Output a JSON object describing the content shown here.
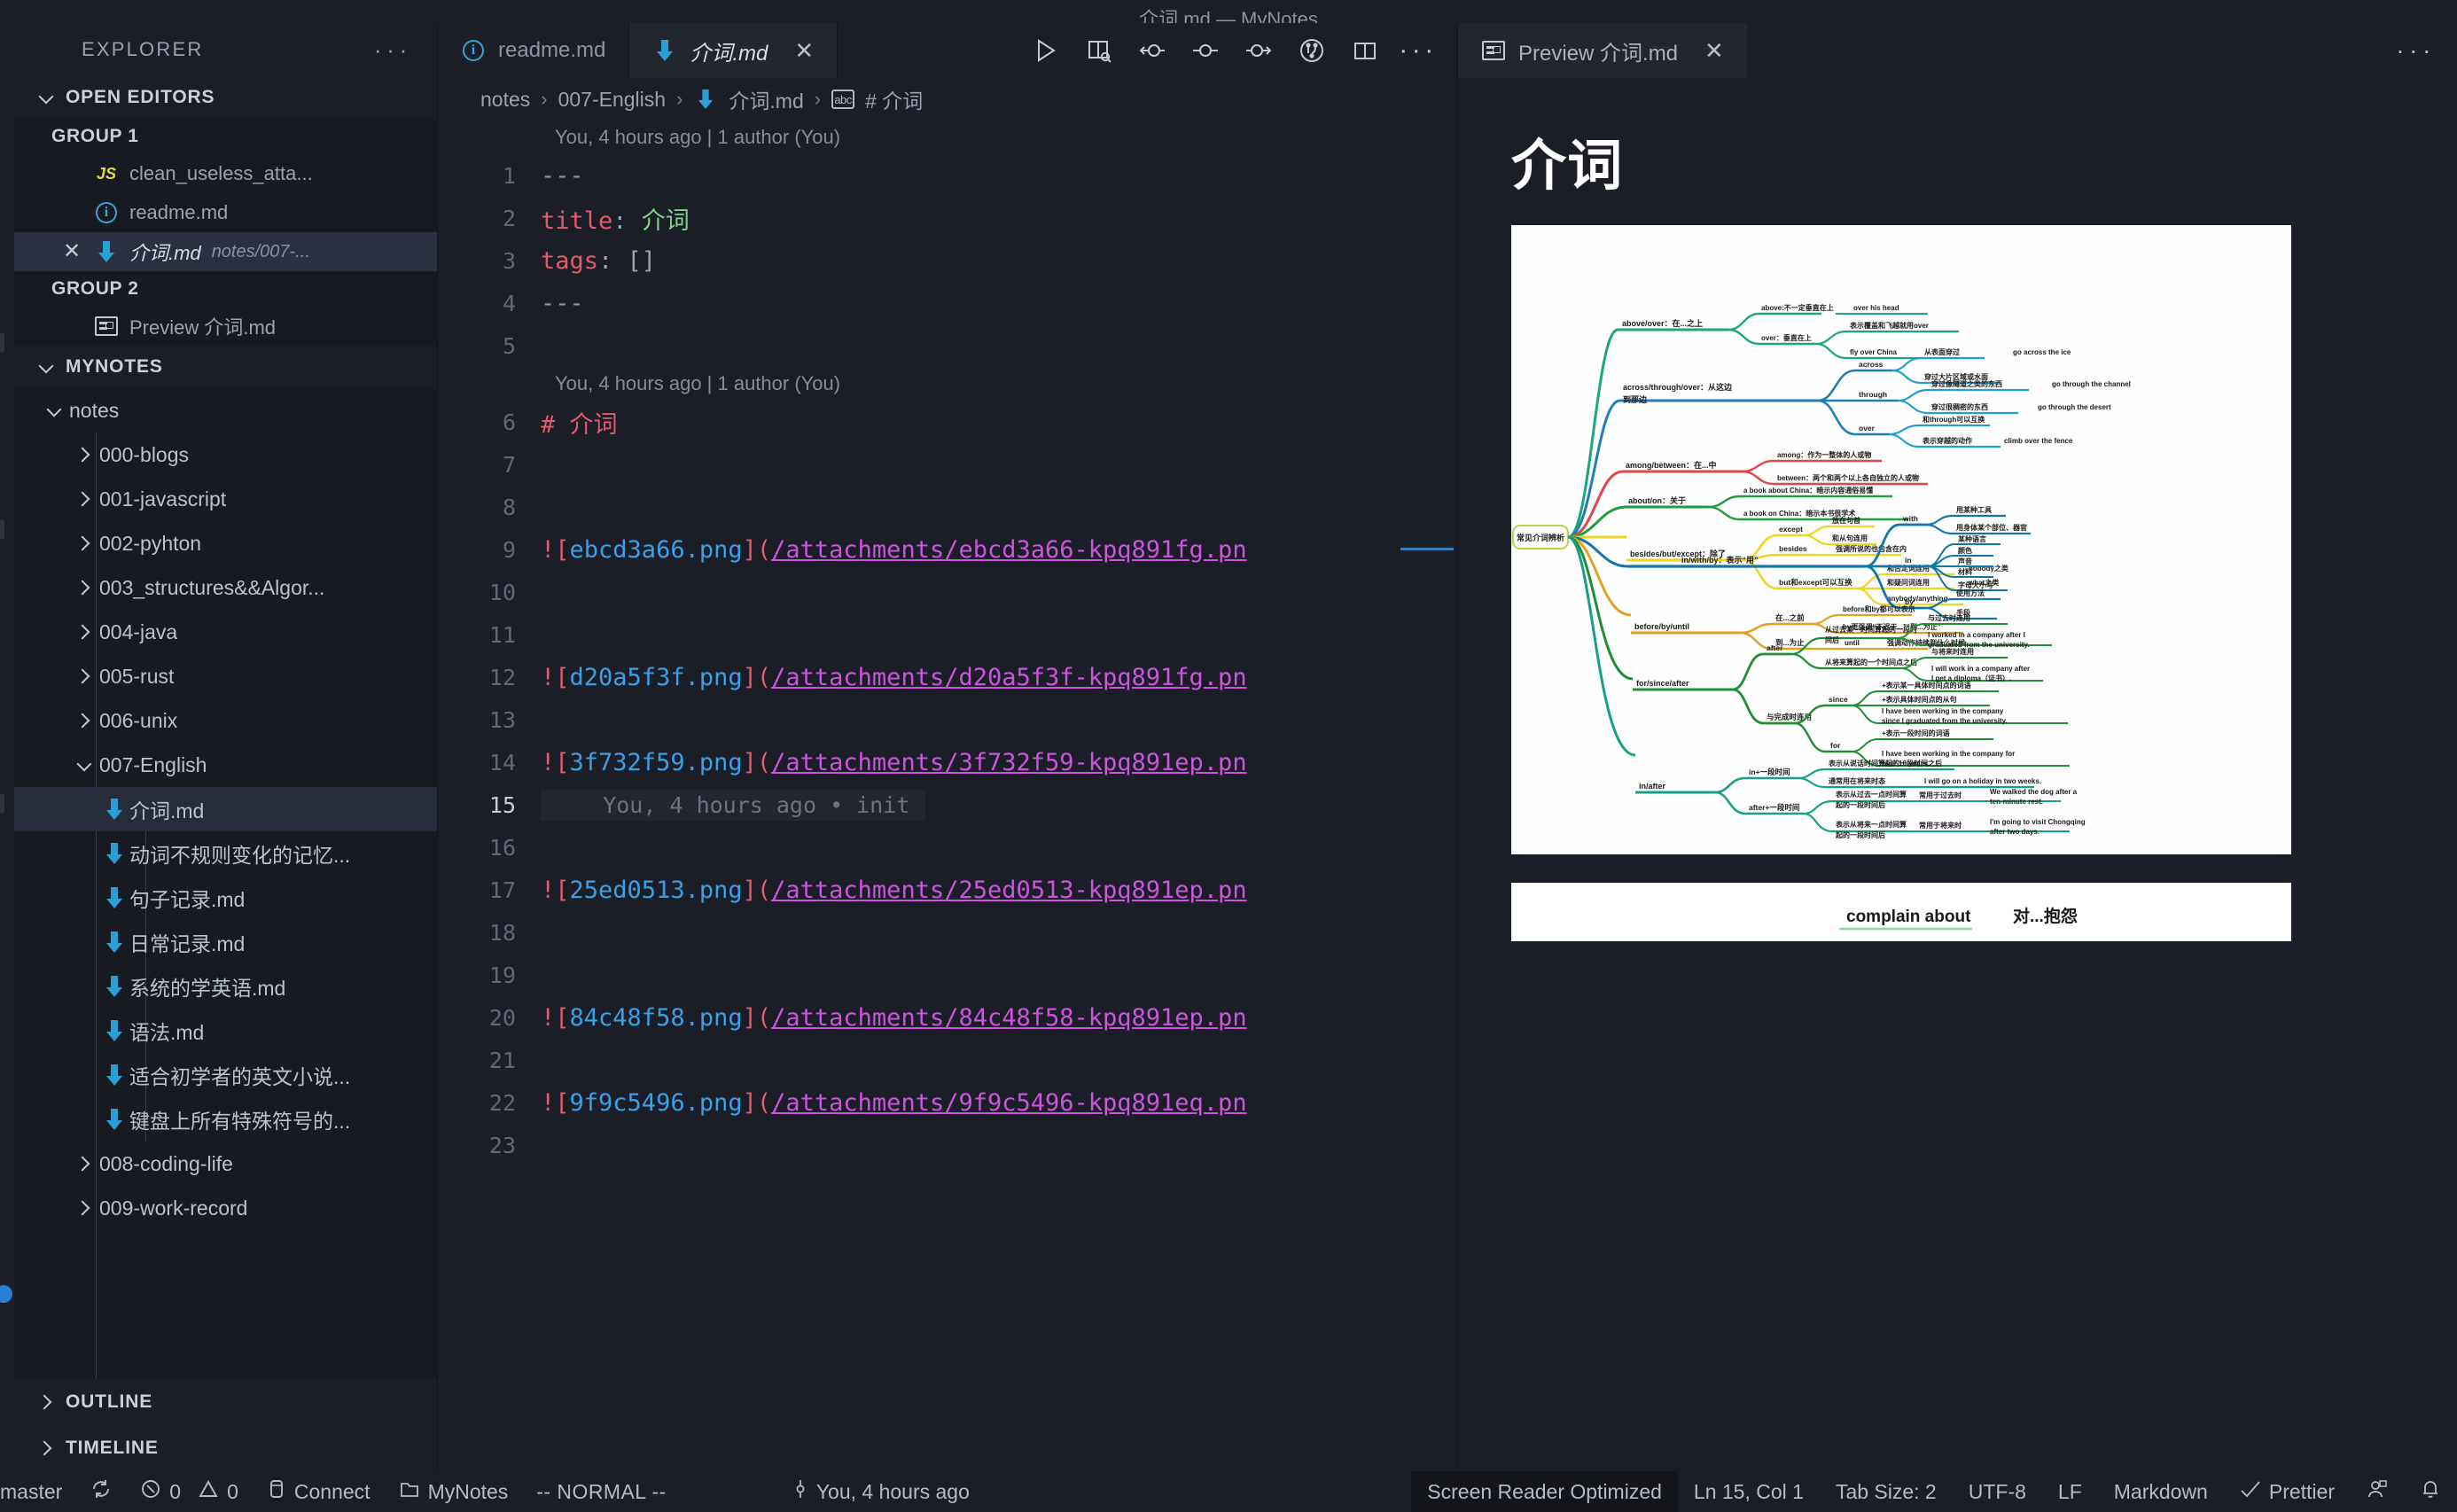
{
  "window": {
    "title": "介词.md — MyNotes"
  },
  "sidebar": {
    "header": {
      "label": "EXPLORER",
      "more": "···"
    },
    "open_editors": {
      "label": "OPEN EDITORS",
      "groups": [
        {
          "label": "GROUP 1",
          "items": [
            {
              "name": "clean_useless_atta...",
              "icon": "js-icon",
              "path": "",
              "active": false,
              "closable": false
            },
            {
              "name": "readme.md",
              "icon": "info-icon",
              "path": "",
              "active": false,
              "closable": false
            },
            {
              "name": "介词.md",
              "icon": "markdown-arrow-icon",
              "path": "notes/007-...",
              "active": true,
              "closable": true
            }
          ]
        },
        {
          "label": "GROUP 2",
          "items": [
            {
              "name": "Preview 介词.md",
              "icon": "preview-icon",
              "path": "",
              "active": false,
              "closable": false
            }
          ]
        }
      ]
    },
    "workspace": {
      "label": "MYNOTES",
      "tree": [
        {
          "label": "notes",
          "type": "folder",
          "expanded": true,
          "depth": 0
        },
        {
          "label": "000-blogs",
          "type": "folder",
          "expanded": false,
          "depth": 1
        },
        {
          "label": "001-javascript",
          "type": "folder",
          "expanded": false,
          "depth": 1
        },
        {
          "label": "002-pyhton",
          "type": "folder",
          "expanded": false,
          "depth": 1
        },
        {
          "label": "003_structures&&Algor...",
          "type": "folder",
          "expanded": false,
          "depth": 1
        },
        {
          "label": "004-java",
          "type": "folder",
          "expanded": false,
          "depth": 1
        },
        {
          "label": "005-rust",
          "type": "folder",
          "expanded": false,
          "depth": 1
        },
        {
          "label": "006-unix",
          "type": "folder",
          "expanded": false,
          "depth": 1
        },
        {
          "label": "007-English",
          "type": "folder",
          "expanded": true,
          "depth": 1
        },
        {
          "label": "介词.md",
          "type": "markdown",
          "depth": 2,
          "selected": true
        },
        {
          "label": "动词不规则变化的记忆...",
          "type": "markdown",
          "depth": 2
        },
        {
          "label": "句子记录.md",
          "type": "markdown",
          "depth": 2
        },
        {
          "label": "日常记录.md",
          "type": "markdown",
          "depth": 2
        },
        {
          "label": "系统的学英语.md",
          "type": "markdown",
          "depth": 2
        },
        {
          "label": "语法.md",
          "type": "markdown",
          "depth": 2
        },
        {
          "label": "适合初学者的英文小说...",
          "type": "markdown",
          "depth": 2
        },
        {
          "label": "键盘上所有特殊符号的...",
          "type": "markdown",
          "depth": 2
        },
        {
          "label": "008-coding-life",
          "type": "folder",
          "expanded": false,
          "depth": 1
        },
        {
          "label": "009-work-record",
          "type": "folder",
          "expanded": false,
          "depth": 1
        }
      ]
    },
    "outline": {
      "label": "OUTLINE"
    },
    "timeline": {
      "label": "TIMELINE"
    }
  },
  "editor": {
    "tabs": [
      {
        "label": "readme.md",
        "icon": "info-icon",
        "active": false,
        "closable": false
      },
      {
        "label": "介词.md",
        "icon": "markdown-arrow-icon",
        "active": true,
        "closable": true
      }
    ],
    "toolbar": [
      {
        "name": "run-icon"
      },
      {
        "name": "open-preview-to-side-icon"
      },
      {
        "name": "go-to-previous-change-icon"
      },
      {
        "name": "current-change-icon"
      },
      {
        "name": "go-to-next-change-icon"
      },
      {
        "name": "source-control-icon"
      },
      {
        "name": "split-editor-icon"
      },
      {
        "name": "more-actions-icon"
      }
    ],
    "breadcrumb": [
      "notes",
      "007-English",
      "介词.md",
      "# 介词"
    ],
    "codelens": [
      {
        "line": 1,
        "text": "You, 4 hours ago | 1 author (You)"
      },
      {
        "line": 6,
        "text": "You, 4 hours ago | 1 author (You)"
      }
    ],
    "inline_blame": "You, 4 hours ago • init",
    "lines": [
      {
        "n": 1,
        "tokens": [
          {
            "t": "---",
            "c": "t-dash"
          }
        ]
      },
      {
        "n": 2,
        "tokens": [
          {
            "t": "title",
            "c": "t-key"
          },
          {
            "t": ": ",
            "c": "t-brk"
          },
          {
            "t": "介词",
            "c": "t-val"
          }
        ]
      },
      {
        "n": 3,
        "tokens": [
          {
            "t": "tags",
            "c": "t-key"
          },
          {
            "t": ": ",
            "c": "t-brk"
          },
          {
            "t": "[]",
            "c": "t-brk"
          }
        ]
      },
      {
        "n": 4,
        "tokens": [
          {
            "t": "---",
            "c": "t-dash"
          }
        ]
      },
      {
        "n": 5,
        "tokens": []
      },
      {
        "n": 6,
        "tokens": [
          {
            "t": "# 介词",
            "c": "t-h1"
          }
        ]
      },
      {
        "n": 7,
        "tokens": []
      },
      {
        "n": 8,
        "tokens": []
      },
      {
        "n": 9,
        "tokens": [
          {
            "t": "!",
            "c": "t-bang"
          },
          {
            "t": "[",
            "c": "t-brkt"
          },
          {
            "t": "ebcd3a66.png",
            "c": "t-alt"
          },
          {
            "t": "]",
            "c": "t-brkt"
          },
          {
            "t": "(",
            "c": "t-brkt"
          },
          {
            "t": "/attachments/ebcd3a66-kpq891fg.pn",
            "c": "t-url"
          }
        ]
      },
      {
        "n": 10,
        "tokens": []
      },
      {
        "n": 11,
        "tokens": []
      },
      {
        "n": 12,
        "tokens": [
          {
            "t": "!",
            "c": "t-bang"
          },
          {
            "t": "[",
            "c": "t-brkt"
          },
          {
            "t": "d20a5f3f.png",
            "c": "t-alt"
          },
          {
            "t": "]",
            "c": "t-brkt"
          },
          {
            "t": "(",
            "c": "t-brkt"
          },
          {
            "t": "/attachments/d20a5f3f-kpq891fg.pn",
            "c": "t-url"
          }
        ]
      },
      {
        "n": 13,
        "tokens": []
      },
      {
        "n": 14,
        "tokens": [
          {
            "t": "!",
            "c": "t-bang"
          },
          {
            "t": "[",
            "c": "t-brkt"
          },
          {
            "t": "3f732f59.png",
            "c": "t-alt"
          },
          {
            "t": "]",
            "c": "t-brkt"
          },
          {
            "t": "(",
            "c": "t-brkt"
          },
          {
            "t": "/attachments/3f732f59-kpq891ep.pn",
            "c": "t-url"
          }
        ]
      },
      {
        "n": 15,
        "tokens": [],
        "current": true
      },
      {
        "n": 16,
        "tokens": []
      },
      {
        "n": 17,
        "tokens": [
          {
            "t": "!",
            "c": "t-bang"
          },
          {
            "t": "[",
            "c": "t-brkt"
          },
          {
            "t": "25ed0513.png",
            "c": "t-alt"
          },
          {
            "t": "]",
            "c": "t-brkt"
          },
          {
            "t": "(",
            "c": "t-brkt"
          },
          {
            "t": "/attachments/25ed0513-kpq891ep.pn",
            "c": "t-url"
          }
        ]
      },
      {
        "n": 18,
        "tokens": []
      },
      {
        "n": 19,
        "tokens": []
      },
      {
        "n": 20,
        "tokens": [
          {
            "t": "!",
            "c": "t-bang"
          },
          {
            "t": "[",
            "c": "t-brkt"
          },
          {
            "t": "84c48f58.png",
            "c": "t-alt"
          },
          {
            "t": "]",
            "c": "t-brkt"
          },
          {
            "t": "(",
            "c": "t-brkt"
          },
          {
            "t": "/attachments/84c48f58-kpq891ep.pn",
            "c": "t-url"
          }
        ]
      },
      {
        "n": 21,
        "tokens": []
      },
      {
        "n": 22,
        "tokens": [
          {
            "t": "!",
            "c": "t-bang"
          },
          {
            "t": "[",
            "c": "t-brkt"
          },
          {
            "t": "9f9c5496.png",
            "c": "t-alt"
          },
          {
            "t": "]",
            "c": "t-brkt"
          },
          {
            "t": "(",
            "c": "t-brkt"
          },
          {
            "t": "/attachments/9f9c5496-kpq891eq.pn",
            "c": "t-url"
          }
        ]
      },
      {
        "n": 23,
        "tokens": []
      }
    ]
  },
  "preview": {
    "tab": {
      "label": "Preview 介词.md",
      "icon": "preview-icon"
    },
    "more": "···",
    "heading": "介词",
    "mindmap": {
      "root": "常见介词辨析",
      "branches": [
        {
          "label": "above/over：在...之上",
          "color": "#1aa67f",
          "children": [
            {
              "label": "above:不一定垂直在上",
              "examples": [
                "over his head"
              ]
            },
            {
              "label": "over：垂直在上",
              "children": [
                "表示覆盖和飞越就用over",
                "fly over China"
              ]
            }
          ]
        },
        {
          "label": "across/through/over：从这边到那边",
          "color": "#1f7fb5",
          "children": [
            {
              "label": "across",
              "children": [
                "从表面穿过",
                "穿过大片区域或水面"
              ],
              "examples": [
                "go across the ice"
              ]
            },
            {
              "label": "through",
              "children": [
                "穿过像隧道之类的东西",
                "穿过很稠密的东西"
              ],
              "examples": [
                "go through the channel",
                "go through the desert"
              ]
            },
            {
              "label": "over",
              "children": [
                "和through可以互换",
                "表示穿越的动作"
              ],
              "examples": [
                "climb over the fence"
              ]
            }
          ]
        },
        {
          "label": "among/between：在...中",
          "color": "#e0464a",
          "children": [
            {
              "label": "among：作为一整体的人或物"
            },
            {
              "label": "between：两个和两个以上各自独立的人或物"
            }
          ]
        },
        {
          "label": "about/on：关于",
          "color": "#1f9e3e",
          "children": [
            {
              "label": "a book about China：暗示内容通俗易懂"
            },
            {
              "label": "a book on China：暗示本书很学术"
            }
          ]
        },
        {
          "label": "besides/but/except：除了",
          "color": "#efd423",
          "children": [
            {
              "label": "except",
              "children": [
                "放在句首",
                "和从句连用"
              ]
            },
            {
              "label": "besides",
              "children": [
                "强调所说的也包含在内"
              ]
            },
            {
              "label": "but和except可以互换",
              "children": [
                "和否定词连用",
                "和疑问词连用",
                "anybody/anything"
              ],
              "examples": [
                "nobody之类",
                "what之类"
              ]
            }
          ]
        },
        {
          "label": "in/with/by：表示“用”",
          "color": "#1176a8",
          "children": [
            {
              "label": "with",
              "children": [
                "用某种工具",
                "用身体某个部位、器官"
              ]
            },
            {
              "label": "in",
              "children": [
                "某种语言",
                "颜色",
                "声音",
                "材料",
                "字母大小写"
              ]
            },
            {
              "label": "by",
              "children": [
                "使用方法",
                "手段"
              ]
            }
          ]
        },
        {
          "label": "before/by/until",
          "color": "#e2a024",
          "children": [
            {
              "label": "在...之前",
              "children": [
                "before和by都可以表示",
                "by更强调“不迟于...”“到...为止”"
              ]
            },
            {
              "label": "到...为止",
              "children": [
                "until"
              ],
              "examples": [
                "强调动作持续到什么时候"
              ]
            }
          ]
        },
        {
          "label": "for/since/after",
          "color": "#1f8f33",
          "children": [
            {
              "label": "after",
              "children": [
                "从过去某一时间算起的一段时间后",
                "从将来算起的一个时间点之后"
              ],
              "examples": [
                "与过去时连用",
                "I worked in a company after I graduated from the university.",
                "与将来时连用",
                "I will work in a company after I get a diploma（证书）."
              ]
            },
            {
              "label": "与完成时连用",
              "children": [
                "since",
                "for"
              ],
              "examples": [
                "+表示某一具体时间点的词语",
                "+表示具体时间点的从句",
                "I have been working in the company since I graduated from the university.",
                "+表示一段时间的词语",
                "I have been working in the company for over 10 years."
              ]
            }
          ]
        },
        {
          "label": "in/after",
          "color": "#16a085",
          "children": [
            {
              "label": "in+一段时间",
              "children": [
                "表示从说话时间算起的一段时间之后",
                "通常用在将来时态"
              ],
              "examples": [
                "I will go on a holiday in two weeks."
              ]
            },
            {
              "label": "after+一段时间",
              "children": [
                "表示从过去一点时间算起的一段时间后",
                "表示从将来一点时间算起的一段时间后"
              ],
              "examples": [
                "常用于过去时",
                "We walked the dog after a ten-minute rest.",
                "常用于将来时",
                "I'm going to visit Chongqing after two days."
              ]
            }
          ]
        }
      ]
    },
    "second_image": {
      "phrase": "complain about",
      "meaning": "对...抱怨"
    }
  },
  "statusbar": {
    "left": [
      {
        "name": "branch",
        "icon": "source-control-icon",
        "label": "master"
      },
      {
        "name": "sync",
        "icon": "sync-icon",
        "label": ""
      },
      {
        "name": "problems",
        "icon": "error-icon",
        "label": "0",
        "icon2": "warning-icon",
        "label2": "0"
      },
      {
        "name": "connect",
        "icon": "remote-icon",
        "label": "Connect"
      },
      {
        "name": "workspace",
        "icon": "folder-icon",
        "label": "MyNotes"
      },
      {
        "name": "vim-mode",
        "icon": "",
        "label": "-- NORMAL --"
      },
      {
        "name": "git-blame",
        "icon": "git-commit-icon",
        "label": "You, 4 hours ago"
      }
    ],
    "right": [
      {
        "name": "screen-reader",
        "label": "Screen Reader Optimized"
      },
      {
        "name": "cursor-position",
        "label": "Ln 15, Col 1"
      },
      {
        "name": "tab-size",
        "label": "Tab Size: 2"
      },
      {
        "name": "encoding",
        "label": "UTF-8"
      },
      {
        "name": "eol",
        "label": "LF"
      },
      {
        "name": "language-mode",
        "label": "Markdown"
      },
      {
        "name": "prettier",
        "icon": "check-icon",
        "label": "Prettier"
      },
      {
        "name": "accounts",
        "icon": "account-icon",
        "label": ""
      },
      {
        "name": "notifications",
        "icon": "bell-icon",
        "label": ""
      }
    ]
  }
}
